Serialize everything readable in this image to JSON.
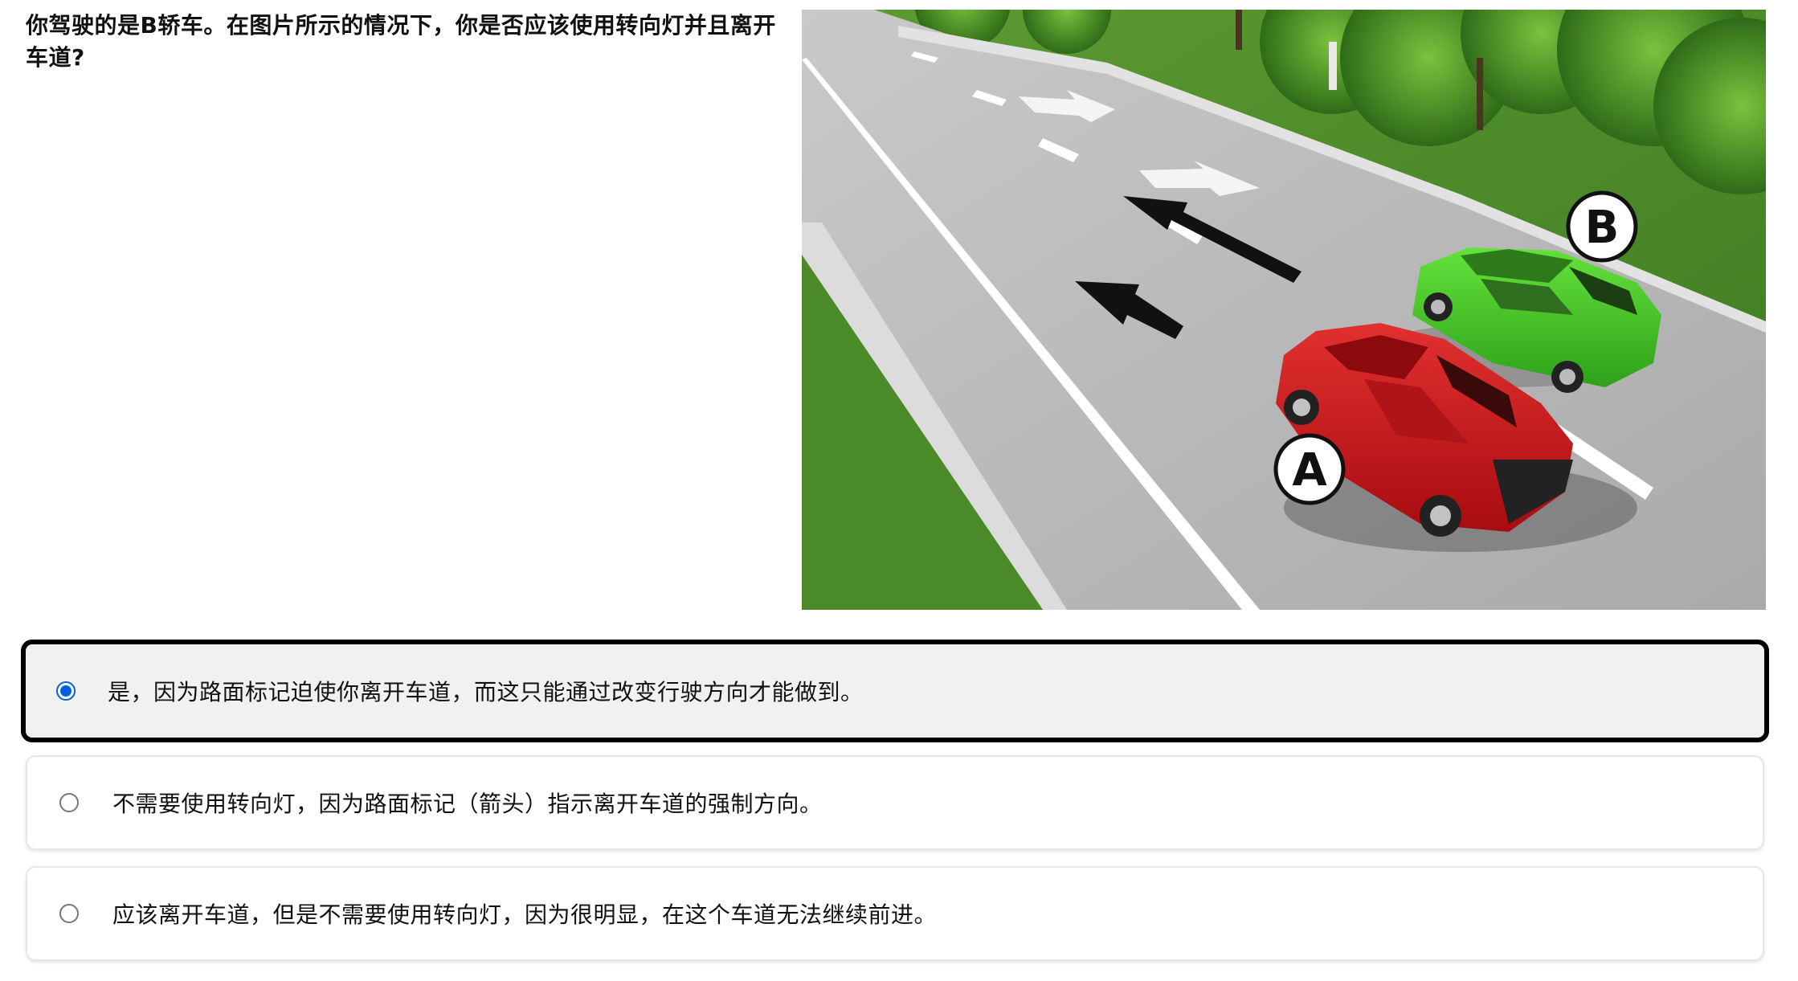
{
  "question": {
    "text": "你驾驶的是B轿车。在图片所示的情况下，你是否应该使用转向灯并且离开车道?"
  },
  "illustration": {
    "car_a_label": "A",
    "car_b_label": "B",
    "colors": {
      "car_a": "#d0141a",
      "car_b": "#3fcc1f",
      "road": "#b9b9b9",
      "grass": "#4f8f2a",
      "marking": "#ffffff",
      "arrow": "#111111"
    }
  },
  "answers": [
    {
      "text": "是，因为路面标记迫使你离开车道，而这只能通过改变行驶方向才能做到。",
      "selected": true
    },
    {
      "text": "不需要使用转向灯，因为路面标记（箭头）指示离开车道的强制方向。",
      "selected": false
    },
    {
      "text": "应该离开车道，但是不需要使用转向灯，因为很明显，在这个车道无法继续前进。",
      "selected": false
    }
  ]
}
